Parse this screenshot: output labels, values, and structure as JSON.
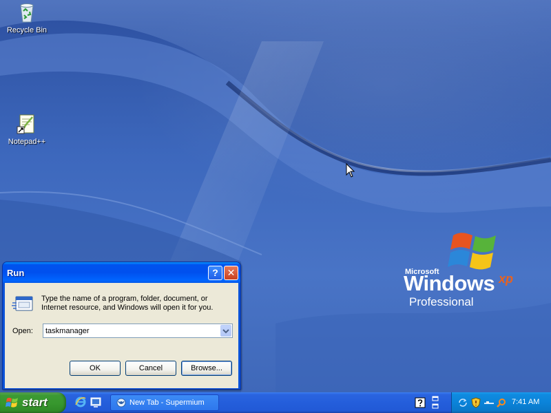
{
  "desktop": {
    "icons": [
      {
        "label": "Recycle Bin",
        "icon": "recycle-bin-icon"
      },
      {
        "label": "Notepad++",
        "icon": "notepad-plus-plus-icon"
      }
    ],
    "branding": {
      "company": "Microsoft",
      "product": "Windows",
      "version_mark": "xp",
      "edition": "Professional"
    }
  },
  "run_dialog": {
    "title": "Run",
    "help_glyph": "?",
    "close_glyph": "✕",
    "description": "Type the name of a program, folder, document, or Internet resource, and Windows will open it for you.",
    "open_label": "Open:",
    "open_value": "taskmanager",
    "ok_label": "OK",
    "cancel_label": "Cancel",
    "browse_label": "Browse..."
  },
  "taskbar": {
    "start_label": "start",
    "quick_launch": [
      "internet-explorer-icon",
      "show-desktop-icon"
    ],
    "tasks": [
      {
        "label": "New Tab - Supermium",
        "icon": "supermium-browser-icon"
      }
    ],
    "tray_icons": [
      "sync-icon",
      "security-shield-icon",
      "network-icon",
      "search-icon"
    ],
    "clock": "7:41 AM"
  },
  "colors": {
    "titlebar_blue": "#0053ee",
    "start_green": "#37972e",
    "tray_blue": "#0b83d9",
    "dialog_face": "#ece9d8",
    "desktop_blue": "#3d68bd"
  }
}
